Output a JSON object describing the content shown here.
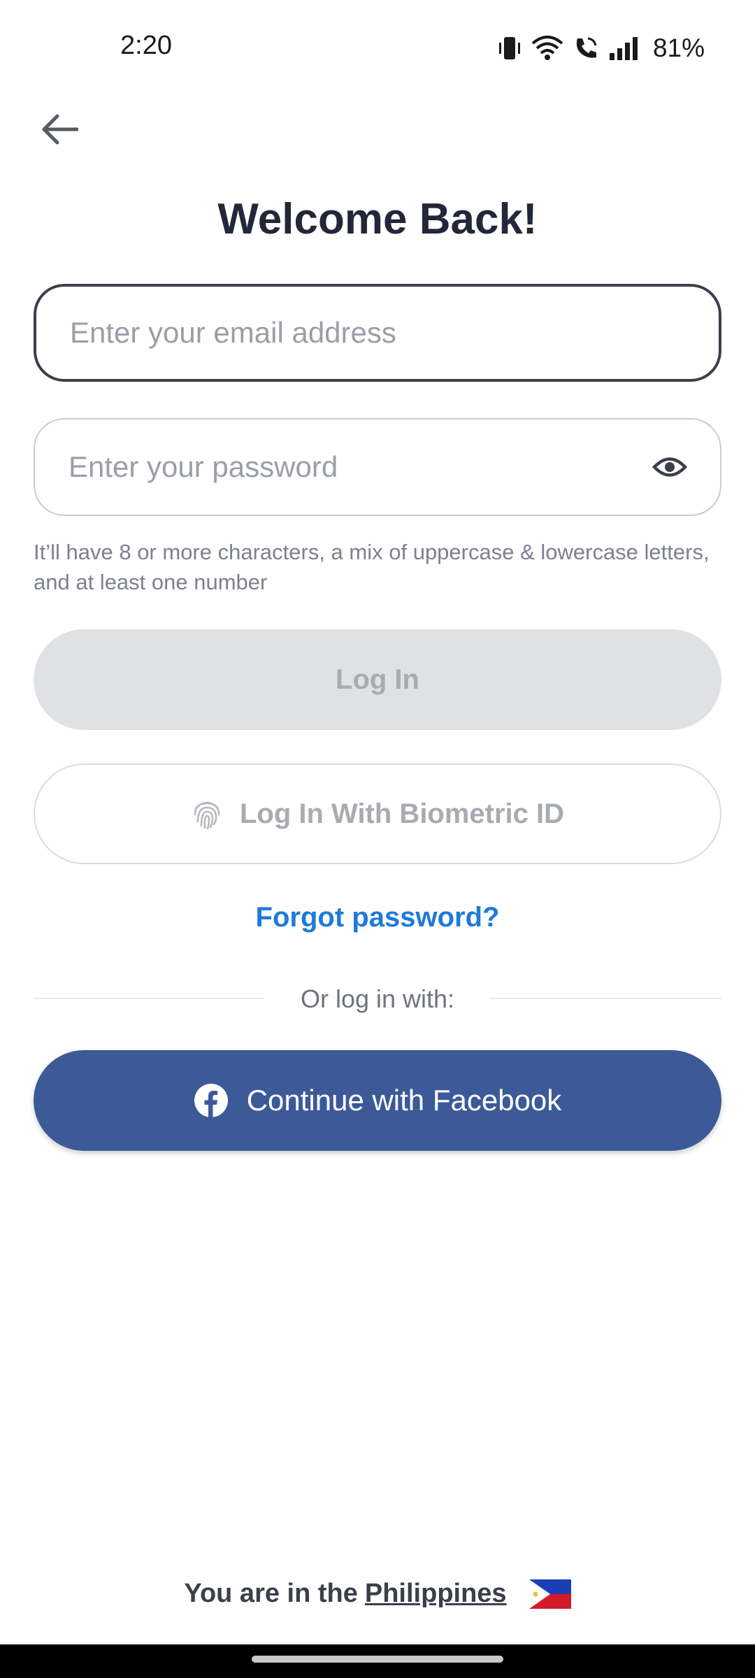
{
  "status_bar": {
    "time": "2:20",
    "battery": "81%",
    "icons": [
      "vibrate-icon",
      "wifi-icon",
      "wifi-call-icon",
      "signal-icon"
    ]
  },
  "header": {
    "back_icon": "arrow-left-icon",
    "title": "Welcome Back!"
  },
  "form": {
    "email_placeholder": "Enter your email address",
    "email_value": "",
    "password_placeholder": "Enter your password",
    "password_value": "",
    "password_icon": "eye-icon",
    "password_hint": "It’ll have 8 or more characters, a mix of uppercase & lowercase letters, and at least one number"
  },
  "actions": {
    "login_label": "Log In",
    "biometric_label": "Log In With Biometric ID",
    "biometric_icon": "fingerprint-icon",
    "forgot_label": "Forgot password?",
    "divider_text": "Or log in with:",
    "facebook_label": "Continue with Facebook",
    "facebook_icon": "facebook-icon"
  },
  "footer": {
    "prefix": "You are in the",
    "country": "Philippines",
    "flag_icon": "philippines-flag-icon"
  },
  "colors": {
    "accent_link": "#1e7ad9",
    "facebook": "#3c5a98",
    "disabled_button": "#e0e1e5",
    "title": "#222839"
  }
}
